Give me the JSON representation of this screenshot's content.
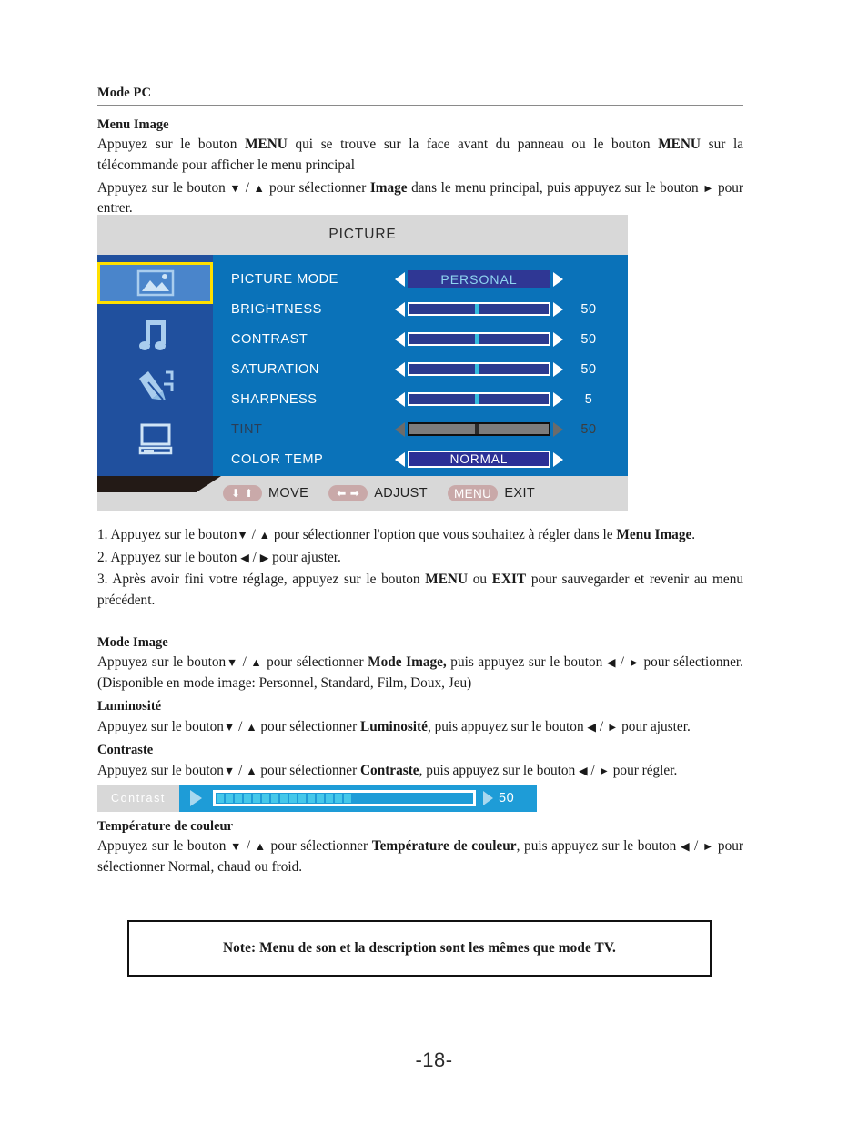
{
  "header": {
    "mode_title": "Mode PC",
    "section_title": "Menu Image",
    "intro_line1": "Appuyez sur le bouton MENU qui se trouve sur la face avant du panneau ou le bouton MENU sur la télécommande pour afficher le menu principal",
    "intro_line2": "Appuyez sur le bouton ▼ / ▲ pour sélectionner Image dans le menu principal, puis appuyez sur le bouton ► pour entrer."
  },
  "osd": {
    "title": "PICTURE",
    "sidebar": [
      {
        "name": "picture-icon",
        "selected": true
      },
      {
        "name": "sound-icon",
        "selected": false
      },
      {
        "name": "setup-icon",
        "selected": false
      },
      {
        "name": "screen-icon",
        "selected": false
      }
    ],
    "rows": [
      {
        "label": "PICTURE MODE",
        "type": "option",
        "value": "PERSONAL",
        "display_value": "",
        "disabled": false
      },
      {
        "label": "BRIGHTNESS",
        "type": "slider",
        "value": "50",
        "percent": 50,
        "disabled": false
      },
      {
        "label": "CONTRAST",
        "type": "slider",
        "value": "50",
        "percent": 50,
        "disabled": false
      },
      {
        "label": "SATURATION",
        "type": "slider",
        "value": "50",
        "percent": 50,
        "disabled": false
      },
      {
        "label": "SHARPNESS",
        "type": "slider",
        "value": "5",
        "percent": 50,
        "disabled": false
      },
      {
        "label": "TINT",
        "type": "slider",
        "value": "50",
        "percent": 50,
        "disabled": true
      },
      {
        "label": "COLOR TEMP",
        "type": "option",
        "value": "NORMAL",
        "disabled": false
      }
    ],
    "footer": [
      {
        "icon": "up-down-arrows-icon",
        "glyphs": "⬇⬆",
        "label": "MOVE"
      },
      {
        "icon": "left-right-arrows-icon",
        "glyphs": "⬅➡",
        "label": "ADJUST"
      },
      {
        "icon": "menu-key-icon",
        "glyphs": "MENU",
        "label": "EXIT"
      }
    ],
    "colors": {
      "header_bg": "#d8d8d8",
      "body_bg": "#0a72b9",
      "sidebar_bg": "#20509e",
      "highlight_border": "#ffe000",
      "slider_track": "#2b3a8f",
      "slider_thumb": "#36bce0",
      "disabled_track": "#7c7c7c"
    }
  },
  "steps": {
    "step1": "1. Appuyez sur le bouton▼ / ▲ pour sélectionner l'option que vous souhaitez à régler dans le Menu Image.",
    "step2": "2. Appuyez sur le bouton ◀ / ▶ pour ajuster.",
    "step3": "3. Après avoir fini votre réglage, appuyez sur le bouton MENU ou EXIT pour sauvegarder et revenir au menu précédent."
  },
  "sections": {
    "mode_image_title": "Mode Image",
    "mode_image_text": "Appuyez sur le bouton▼ / ▲ pour sélectionner Mode Image, puis appuyez sur le bouton ◀ / ► pour sélectionner. (Disponible en mode image: Personnel, Standard, Film, Doux, Jeu)",
    "luminosite_title": "Luminosité",
    "luminosite_text": "Appuyez sur le bouton▼ / ▲ pour sélectionner Luminosité, puis appuyez sur le bouton ◀ / ► pour ajuster.",
    "contraste_title": "Contraste",
    "contraste_text": "Appuyez sur le bouton▼ / ▲ pour sélectionner Contraste, puis appuyez sur le bouton ◀ / ► pour régler.",
    "temp_title": "Température de couleur",
    "temp_text": "Appuyez sur le bouton ▼ / ▲ pour sélectionner Température de couleur, puis appuyez sur le bouton ◀ / ► pour sélectionner Normal, chaud ou froid."
  },
  "contrast_widget": {
    "label": "Contrast",
    "value": "50",
    "segments_filled": 15,
    "colors": {
      "bar_bg": "#1e9cd7",
      "segment": "#45c8ea",
      "label_bg": "#d8d8d8"
    }
  },
  "note": {
    "text": "Note: Menu de son et la description sont les mêmes que mode TV."
  },
  "page_number": "-18-"
}
